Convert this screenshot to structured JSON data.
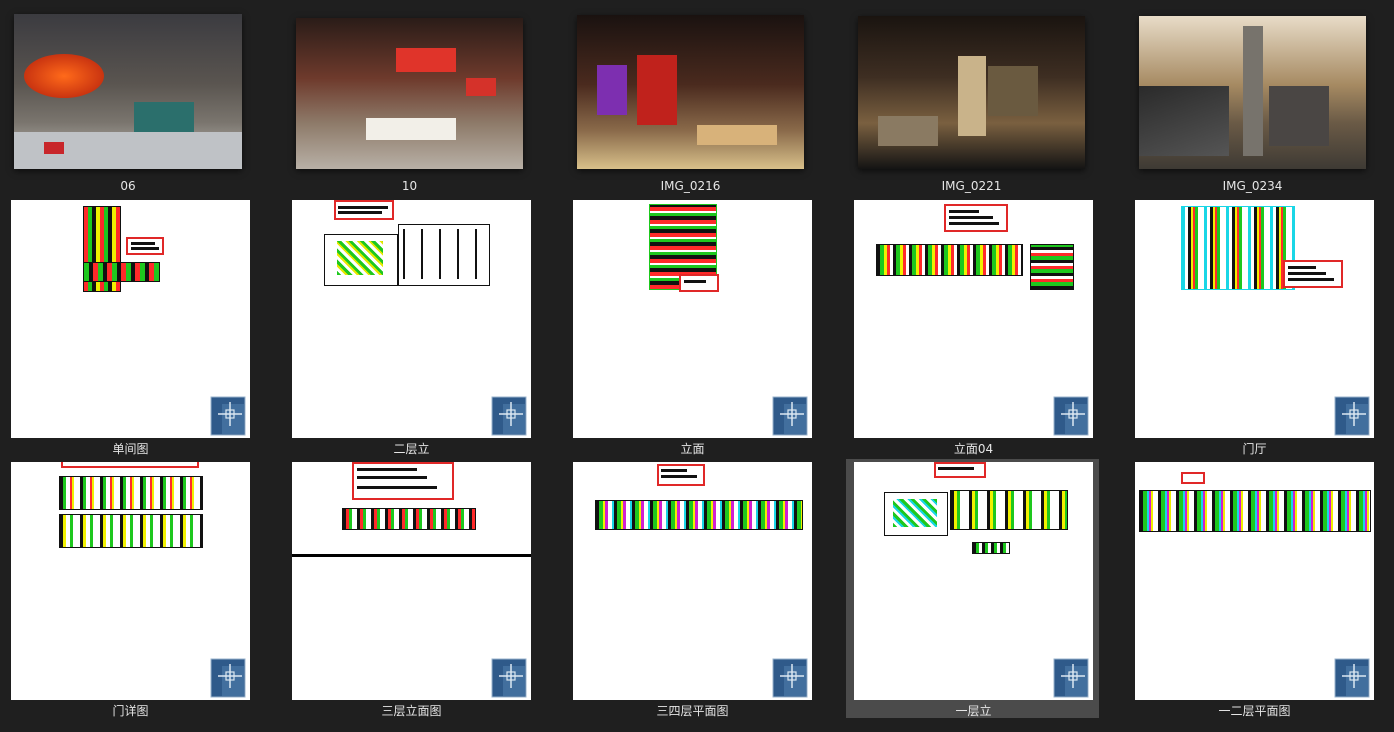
{
  "files": [
    {
      "name": "06",
      "kind": "photo",
      "accent": "#d43a1a"
    },
    {
      "name": "10",
      "kind": "photo",
      "accent": "#c0282a"
    },
    {
      "name": "IMG_0216",
      "kind": "photo",
      "accent": "#b82222"
    },
    {
      "name": "IMG_0221",
      "kind": "photo",
      "accent": "#c89a3a"
    },
    {
      "name": "IMG_0234",
      "kind": "photo",
      "accent": "#b8a27a"
    },
    {
      "name": "单间图",
      "kind": "dwg"
    },
    {
      "name": "二层立",
      "kind": "dwg"
    },
    {
      "name": "立面",
      "kind": "dwg"
    },
    {
      "name": "立面04",
      "kind": "dwg"
    },
    {
      "name": "门厅",
      "kind": "dwg"
    },
    {
      "name": "门详图",
      "kind": "dwg"
    },
    {
      "name": "三层立面图",
      "kind": "dwg"
    },
    {
      "name": "三四层平面图",
      "kind": "dwg"
    },
    {
      "name": "一层立",
      "kind": "dwg",
      "selected": true
    },
    {
      "name": "一二层平面图",
      "kind": "dwg"
    }
  ],
  "icons": {
    "dwg_file": "dwg-file-icon"
  },
  "colors": {
    "background": "#1f1f1f",
    "selection": "#4b4b4b",
    "caption": "#e6e6e6",
    "red_frame": "#e02828"
  }
}
